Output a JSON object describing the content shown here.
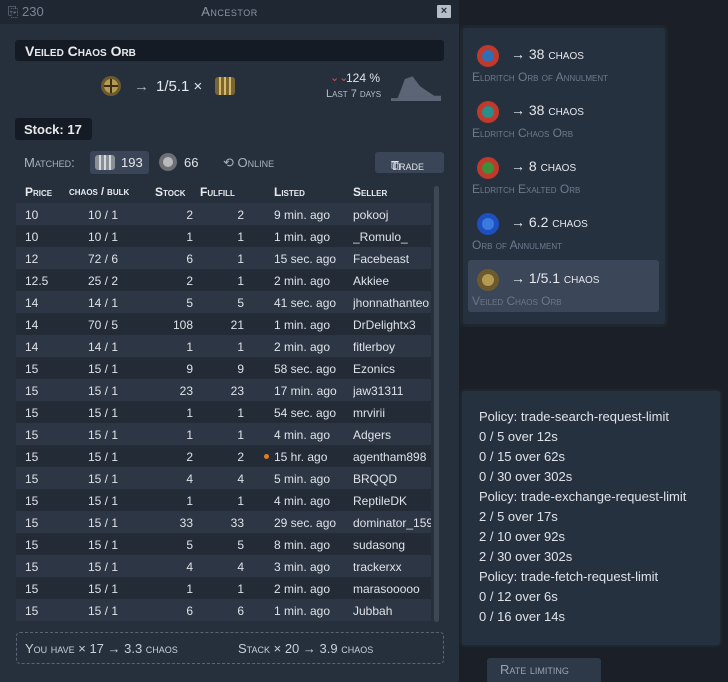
{
  "window": {
    "count": "230",
    "title": "Ancestor",
    "close_glyph": "×"
  },
  "item": {
    "name": "Veiled Chaos Orb",
    "ratio": "1/5.1 ×",
    "arrow": "→"
  },
  "trend": {
    "arrow": "⌄",
    "pct": "124 %",
    "label": "Last 7 days",
    "sparkline": [
      0.1,
      0.1,
      0.9,
      1.0,
      0.6,
      0.4,
      0.2,
      0.2
    ]
  },
  "stock": {
    "label": "Stock: 17"
  },
  "matched": {
    "label": "Matched:",
    "bulk_count": "193",
    "chaos_count": "66",
    "online": "Online",
    "trade_label": "Trade"
  },
  "table": {
    "headers": {
      "price": "Price",
      "bulk": "chaos / bulk",
      "stock": "Stock",
      "fulfill": "Fulfill",
      "listed": "Listed",
      "seller": "Seller"
    },
    "rows": [
      {
        "price": "10",
        "bulk": "10 / 1",
        "stock": "2",
        "fulfill": "2",
        "listed": "9 min. ago",
        "seller": "pokooj",
        "dot": false
      },
      {
        "price": "10",
        "bulk": "10 / 1",
        "stock": "1",
        "fulfill": "1",
        "listed": "1 min. ago",
        "seller": "_Romulo_",
        "dot": false
      },
      {
        "price": "12",
        "bulk": "72 / 6",
        "stock": "6",
        "fulfill": "1",
        "listed": "15 sec. ago",
        "seller": "Facebeast",
        "dot": false
      },
      {
        "price": "12.5",
        "bulk": "25 / 2",
        "stock": "2",
        "fulfill": "1",
        "listed": "2 min. ago",
        "seller": "Akkiee",
        "dot": false
      },
      {
        "price": "14",
        "bulk": "14 / 1",
        "stock": "5",
        "fulfill": "5",
        "listed": "41 sec. ago",
        "seller": "jhonnathanteo",
        "dot": false
      },
      {
        "price": "14",
        "bulk": "70 / 5",
        "stock": "108",
        "fulfill": "21",
        "listed": "1 min. ago",
        "seller": "DrDelightx3",
        "dot": false
      },
      {
        "price": "14",
        "bulk": "14 / 1",
        "stock": "1",
        "fulfill": "1",
        "listed": "2 min. ago",
        "seller": "fitlerboy",
        "dot": false
      },
      {
        "price": "15",
        "bulk": "15 / 1",
        "stock": "9",
        "fulfill": "9",
        "listed": "58 sec. ago",
        "seller": "Ezonics",
        "dot": false
      },
      {
        "price": "15",
        "bulk": "15 / 1",
        "stock": "23",
        "fulfill": "23",
        "listed": "17 min. ago",
        "seller": "jaw31311",
        "dot": false
      },
      {
        "price": "15",
        "bulk": "15 / 1",
        "stock": "1",
        "fulfill": "1",
        "listed": "54 sec. ago",
        "seller": "mrvirii",
        "dot": false
      },
      {
        "price": "15",
        "bulk": "15 / 1",
        "stock": "1",
        "fulfill": "1",
        "listed": "4 min. ago",
        "seller": "Adgers",
        "dot": false
      },
      {
        "price": "15",
        "bulk": "15 / 1",
        "stock": "2",
        "fulfill": "2",
        "listed": "15 hr. ago",
        "seller": "agentham898",
        "dot": true
      },
      {
        "price": "15",
        "bulk": "15 / 1",
        "stock": "4",
        "fulfill": "4",
        "listed": "5 min. ago",
        "seller": "BRQQD",
        "dot": false
      },
      {
        "price": "15",
        "bulk": "15 / 1",
        "stock": "1",
        "fulfill": "1",
        "listed": "4 min. ago",
        "seller": "ReptileDK",
        "dot": false
      },
      {
        "price": "15",
        "bulk": "15 / 1",
        "stock": "33",
        "fulfill": "33",
        "listed": "29 sec. ago",
        "seller": "dominator_159",
        "dot": false
      },
      {
        "price": "15",
        "bulk": "15 / 1",
        "stock": "5",
        "fulfill": "5",
        "listed": "8 min. ago",
        "seller": "sudasong",
        "dot": false
      },
      {
        "price": "15",
        "bulk": "15 / 1",
        "stock": "4",
        "fulfill": "4",
        "listed": "3 min. ago",
        "seller": "trackerxx",
        "dot": false
      },
      {
        "price": "15",
        "bulk": "15 / 1",
        "stock": "1",
        "fulfill": "1",
        "listed": "2 min. ago",
        "seller": "marasooooo",
        "dot": false
      },
      {
        "price": "15",
        "bulk": "15 / 1",
        "stock": "6",
        "fulfill": "6",
        "listed": "1 min. ago",
        "seller": "Jubbah",
        "dot": false
      }
    ]
  },
  "footer": {
    "have": "You have × 17 → 3.3 chaos",
    "stack": "Stack × 20 → 3.9 chaos"
  },
  "rates": [
    {
      "price": "→ 38 chaos",
      "name": "Eldritch Orb of Annulment",
      "orb": "red-blue"
    },
    {
      "price": "→ 38 chaos",
      "name": "Eldritch Chaos Orb",
      "orb": "red-teal"
    },
    {
      "price": "→ 8 chaos",
      "name": "Eldritch Exalted Orb",
      "orb": "red-green"
    },
    {
      "price": "→ 6.2 chaos",
      "name": "Orb of Annulment",
      "orb": "blue"
    },
    {
      "price": "→ 1/5.1 chaos",
      "name": "Veiled Chaos Orb",
      "orb": "veiled",
      "selected": true
    }
  ],
  "limits": [
    "Policy: trade-search-request-limit",
    "0 / 5 over 12s",
    "0 / 15 over 62s",
    "0 / 30 over 302s",
    "Policy: trade-exchange-request-limit",
    "2 / 5 over 17s",
    "2 / 10 over 92s",
    "2 / 30 over 302s",
    "Policy: trade-fetch-request-limit",
    "0 / 12 over 6s",
    "0 / 16 over 14s"
  ],
  "rate_tab": {
    "label": "Rate limiting"
  },
  "colors": {
    "accent_down": "#d9534f",
    "dot": "#e07b22",
    "panel": "#263140"
  }
}
